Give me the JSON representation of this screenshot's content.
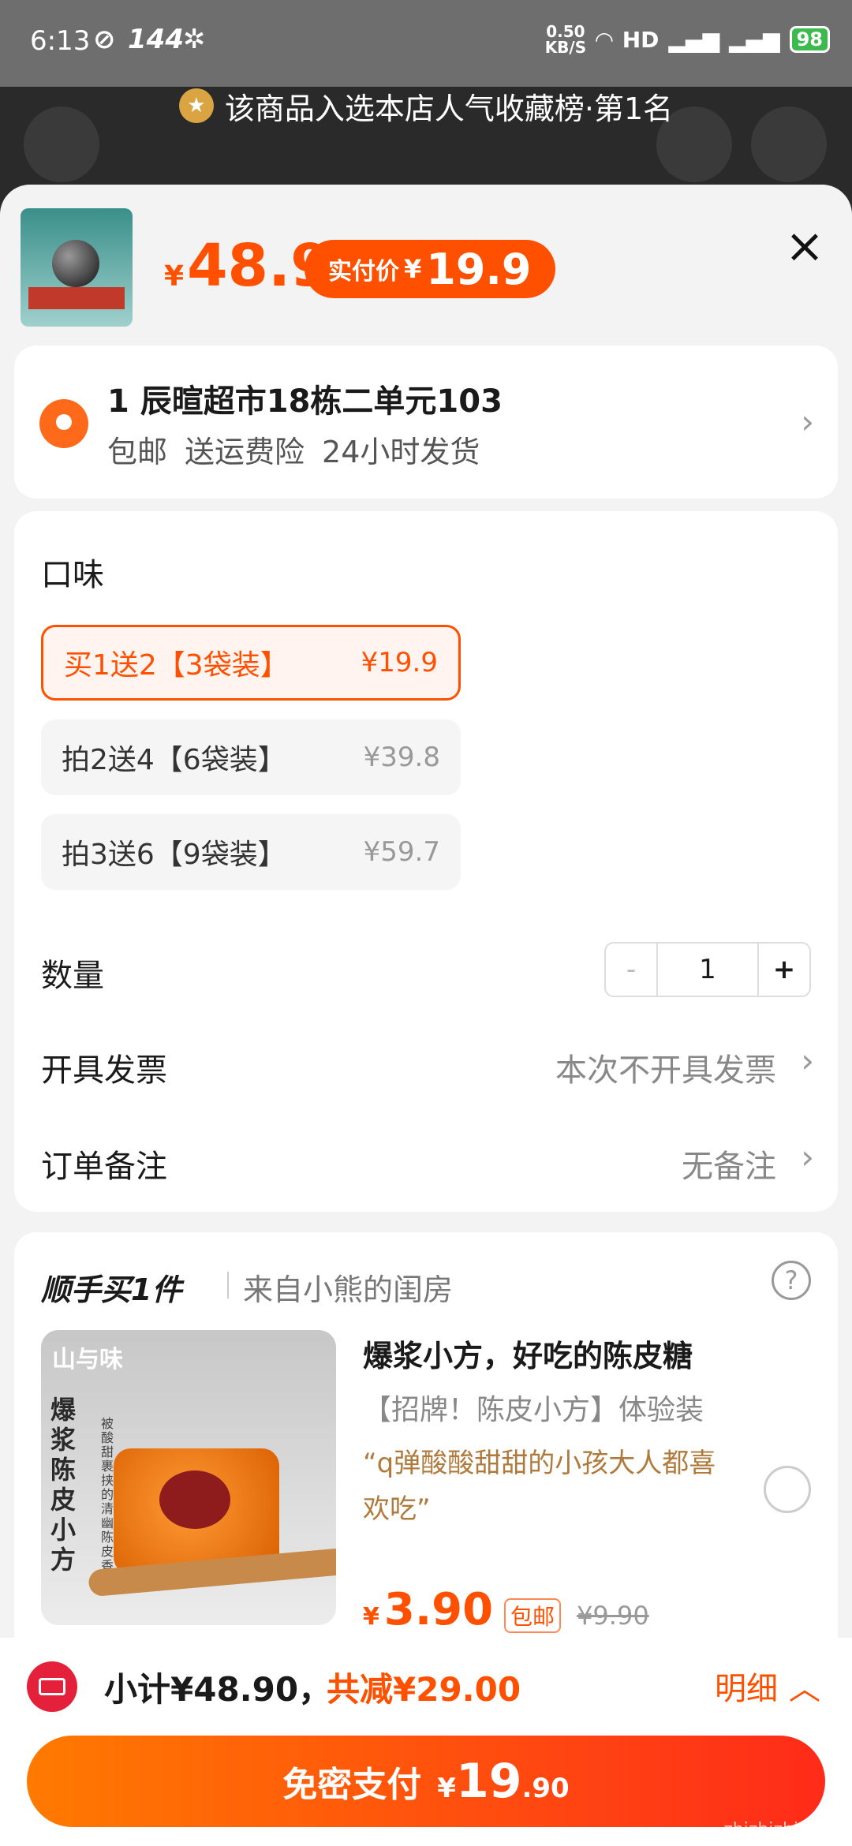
{
  "status_bar": {
    "time": "6:13",
    "refresh": "144",
    "net_speed": "0.50",
    "net_unit": "KB/S",
    "signal": "HD",
    "battery": "98"
  },
  "banner": {
    "text": "该商品入选本店人气收藏榜·第1名"
  },
  "header": {
    "currency": "¥",
    "price": "48.9",
    "actual_label": "实付价",
    "actual_currency": "¥",
    "actual_price": "19.9"
  },
  "address": {
    "line": "1 辰暄超市18栋二单元103",
    "tags": [
      "包邮",
      "送运费险",
      "24小时发货"
    ]
  },
  "flavor": {
    "title": "口味",
    "options": [
      {
        "label": "买1送2【3袋装】",
        "price": "¥19.9",
        "selected": true
      },
      {
        "label": "拍2送4【6袋装】",
        "price": "¥39.8",
        "selected": false
      },
      {
        "label": "拍3送6【9袋装】",
        "price": "¥59.7",
        "selected": false
      }
    ]
  },
  "quantity": {
    "label": "数量",
    "minus": "-",
    "value": "1",
    "plus": "+"
  },
  "invoice": {
    "label": "开具发票",
    "value": "本次不开具发票"
  },
  "note": {
    "label": "订单备注",
    "value": "无备注"
  },
  "extra": {
    "title": "顺手买1件",
    "from": "来自小熊的闺房",
    "product": {
      "brand": "山与味",
      "side_title": "爆浆陈皮小方",
      "side_desc": "被酸甜裹挟的清幽陈皮香",
      "title": "爆浆小方，好吃的陈皮糖",
      "subtitle": "【招牌！陈皮小方】体验装",
      "quote": "“q弹酸酸甜甜的小孩大人都喜欢吃”",
      "currency": "¥",
      "price": "3.90",
      "tag": "包邮",
      "old_price": "¥9.90"
    }
  },
  "bottom": {
    "subtotal": "小计¥48.90，",
    "discount": "共减¥29.00",
    "detail": "明细"
  },
  "pay": {
    "label": "免密支付",
    "currency": "¥",
    "int": "19",
    "dec": ".90"
  },
  "watermark": "zhizhizhi.com",
  "colors": {
    "accent": "#ff5000",
    "sheet": "#f3f3f3"
  }
}
